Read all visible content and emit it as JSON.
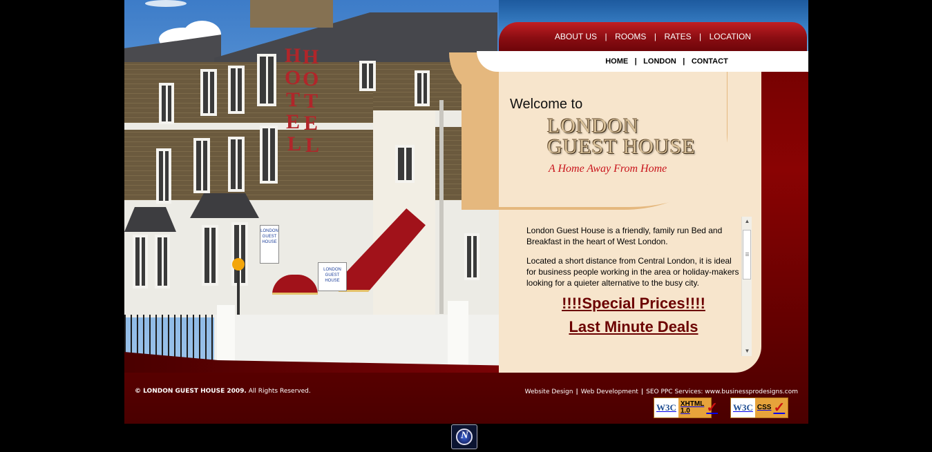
{
  "nav_primary": [
    {
      "label": "ABOUT US"
    },
    {
      "label": "ROOMS"
    },
    {
      "label": "RATES"
    },
    {
      "label": "LOCATION"
    }
  ],
  "nav_secondary": [
    {
      "label": "HOME"
    },
    {
      "label": "LONDON"
    },
    {
      "label": "CONTACT"
    }
  ],
  "separator": "|",
  "hero": {
    "welcome": "Welcome to",
    "brand_line1": "LONDON",
    "brand_line2": "GUEST HOUSE",
    "tagline": "A Home Away From Home",
    "hotel_sign": [
      "H",
      "O",
      "T",
      "E",
      "L"
    ],
    "awning_sign": [
      "LONDON",
      "GUEST",
      "HOUSE"
    ]
  },
  "content": {
    "para1": "London Guest House is a friendly, family run Bed and Breakfast in the heart of West London.",
    "para2": "Located a short distance from Central London, it is ideal for business people working in the area or holiday-makers looking for a quieter alternative to the busy city.",
    "promo1": "!!!!Special Prices!!!!",
    "promo2": "Last Minute Deals"
  },
  "footer": {
    "copyright_bold": "© LONDON GUEST HOUSE 2009.",
    "copyright_rest": " All Rights Reserved.",
    "credits": [
      {
        "label": "Website Design"
      },
      {
        "label": "Web Development"
      },
      {
        "label": "SEO PPC Services: www.businessprodesigns.com"
      }
    ],
    "badges": [
      {
        "w3c": "W3C",
        "label_line1": "XHTML",
        "label_line2": "1.0"
      },
      {
        "w3c": "W3C",
        "label_line1": "CSS",
        "label_line2": ""
      }
    ]
  },
  "icons": {
    "bottom_badge": "n-logo-icon",
    "scroll_up": "scroll-up-arrow-icon",
    "scroll_down": "scroll-down-arrow-icon"
  },
  "colors": {
    "background": "#000000",
    "brand_red": "#8a0303",
    "cream": "#f7e5cc",
    "tan": "#e5b87e",
    "promo": "#6b0000"
  }
}
